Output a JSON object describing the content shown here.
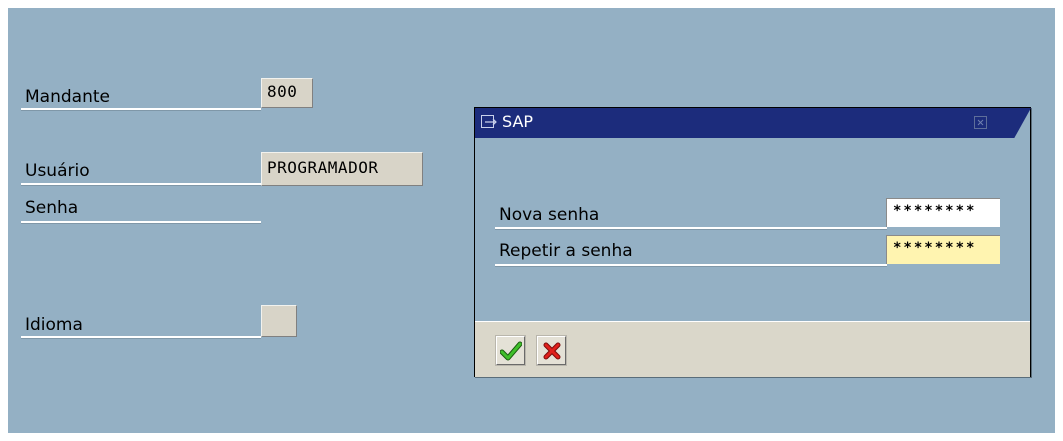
{
  "login": {
    "client_label": "Mandante",
    "client_value": "800",
    "user_label": "Usuário",
    "user_value": "PROGRAMADOR",
    "password_label": "Senha",
    "language_label": "Idioma",
    "language_value": ""
  },
  "dialog": {
    "title": "SAP",
    "new_password_label": "Nova senha",
    "new_password_value": "********",
    "repeat_password_label": "Repetir a senha",
    "repeat_password_value": "********",
    "confirm_icon": "green-checkmark-icon",
    "cancel_icon": "red-x-icon"
  },
  "colors": {
    "background": "#94b0c4",
    "title_bar": "#1c2c7c",
    "highlight_field": "#fff4b0"
  }
}
